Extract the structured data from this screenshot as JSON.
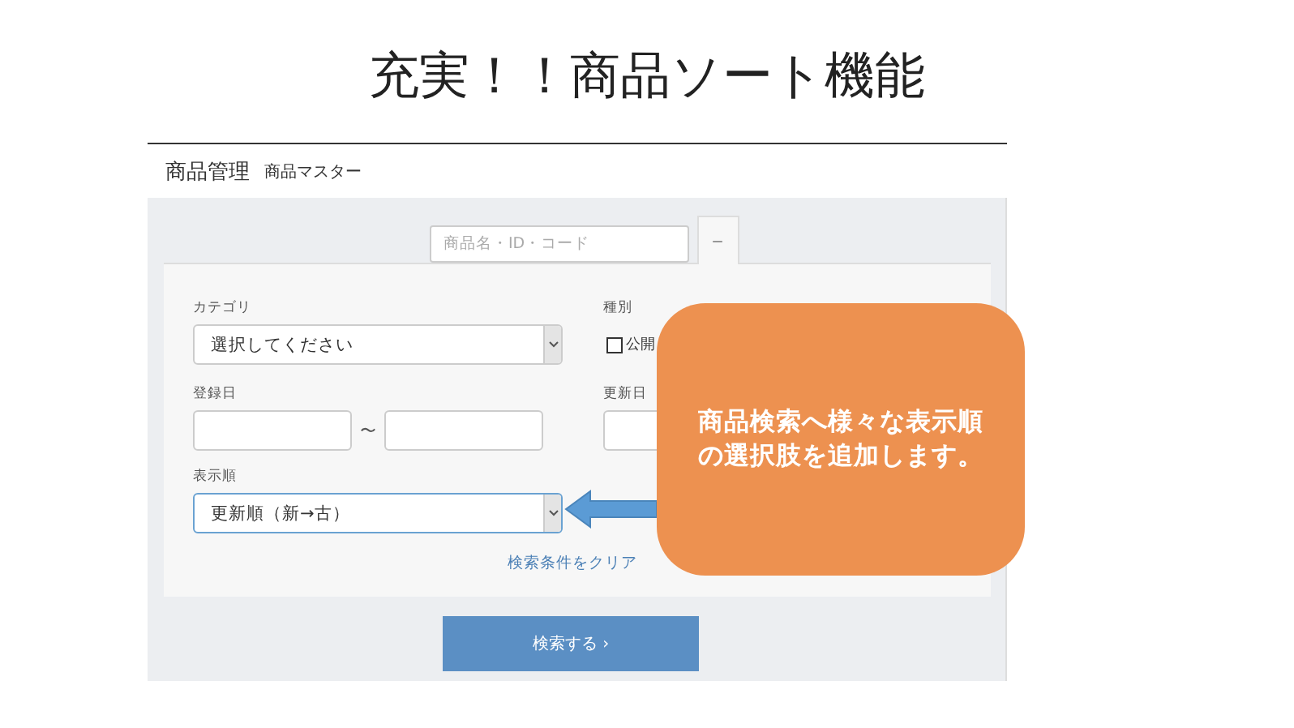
{
  "slide_title": "充実！！商品ソート機能",
  "header": {
    "title": "商品管理",
    "subtitle": "商品マスター"
  },
  "search": {
    "placeholder": "商品名・ID・コード",
    "toggle": "−"
  },
  "form": {
    "category": {
      "label": "カテゴリ",
      "value": "選択してください"
    },
    "type": {
      "label": "種別",
      "options": [
        {
          "label": "公開",
          "checked": false
        }
      ]
    },
    "registered": {
      "label": "登録日",
      "separator": "〜"
    },
    "updated": {
      "label": "更新日"
    },
    "sort": {
      "label": "表示順",
      "value": "更新順（新→古）"
    },
    "clear_link": "検索条件をクリア"
  },
  "search_button": {
    "label": "検索する",
    "arrow": "›"
  },
  "callout": "商品検索へ様々な表示順の選択肢を追加します。"
}
